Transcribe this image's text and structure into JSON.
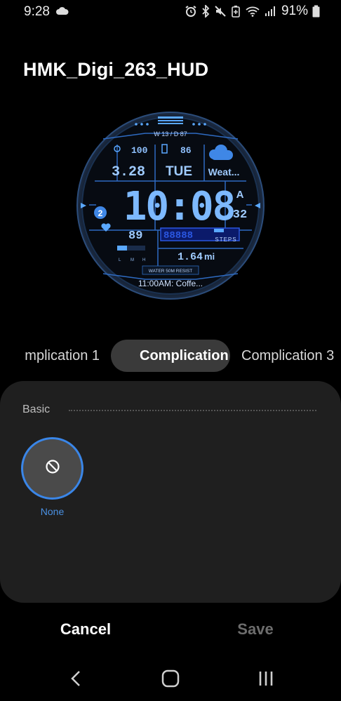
{
  "status_bar": {
    "time": "9:28",
    "battery_percent": "91%",
    "icons": [
      "cloud-icon",
      "alarm-icon",
      "bluetooth-icon",
      "mute-icon",
      "battery-saver-icon",
      "wifi-icon",
      "signal-icon",
      "battery-icon"
    ]
  },
  "title": "HMK_Digi_263_HUD",
  "watch_face": {
    "week_day": "W 13 / D 87",
    "battery": "100",
    "phone_battery": "86",
    "date": "3.28",
    "weekday": "TUE",
    "weather": "Weat...",
    "time": "10:08",
    "ampm": "A",
    "seconds": "32",
    "complication_num": "2",
    "heart_rate": "89",
    "steps_digits": "88888",
    "steps_label": "STEPS",
    "lmh": [
      "L",
      "M",
      "H"
    ],
    "distance": "1.64",
    "distance_unit": "mi",
    "water": "WATER 50M RESIST",
    "event": "11:00AM: Coffe..."
  },
  "tabs": [
    {
      "label": "mplication 1"
    },
    {
      "label": "Complication 2"
    },
    {
      "label": "Complication 3"
    }
  ],
  "panel": {
    "section_label": "Basic",
    "option_label": "None"
  },
  "buttons": {
    "cancel": "Cancel",
    "save": "Save"
  },
  "colors": {
    "accent": "#3a86e8",
    "watch_blue": "#5aa8ff",
    "panel_bg": "#1f1f1f"
  }
}
